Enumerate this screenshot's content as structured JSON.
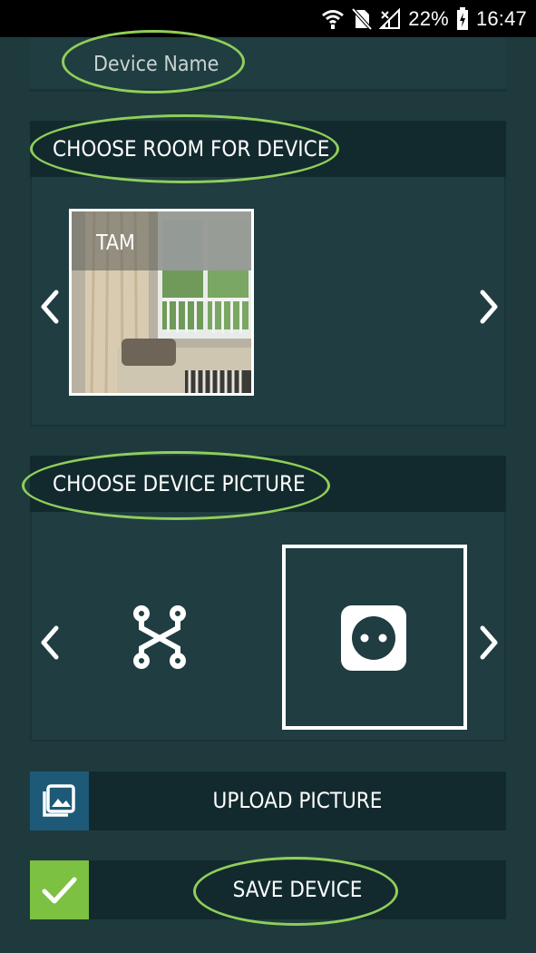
{
  "status_bar": {
    "battery": "22%",
    "time": "16:47",
    "icons": [
      "wifi-icon",
      "no-sim-icon",
      "signal-icon",
      "battery-charging-icon"
    ]
  },
  "device_name": {
    "placeholder": "Device Name"
  },
  "room_section": {
    "title": "CHOOSE ROOM FOR DEVICE",
    "selected_room": "TAM",
    "prev_icon": "chevron-left-icon",
    "next_icon": "chevron-right-icon"
  },
  "picture_section": {
    "title": "CHOOSE DEVICE PICTURE",
    "options": [
      "circuit-icon",
      "power-socket-icon"
    ],
    "selected_option": "power-socket-icon"
  },
  "upload_button": {
    "label": "UPLOAD PICTURE",
    "icon": "image-gallery-icon"
  },
  "save_button": {
    "label": "SAVE DEVICE",
    "icon": "checkmark-icon"
  },
  "colors": {
    "background": "#1f3a3d",
    "header": "#122a2d",
    "upload_accent": "#1e5a78",
    "save_accent": "#7cc142",
    "annotation": "#8fce5a"
  }
}
